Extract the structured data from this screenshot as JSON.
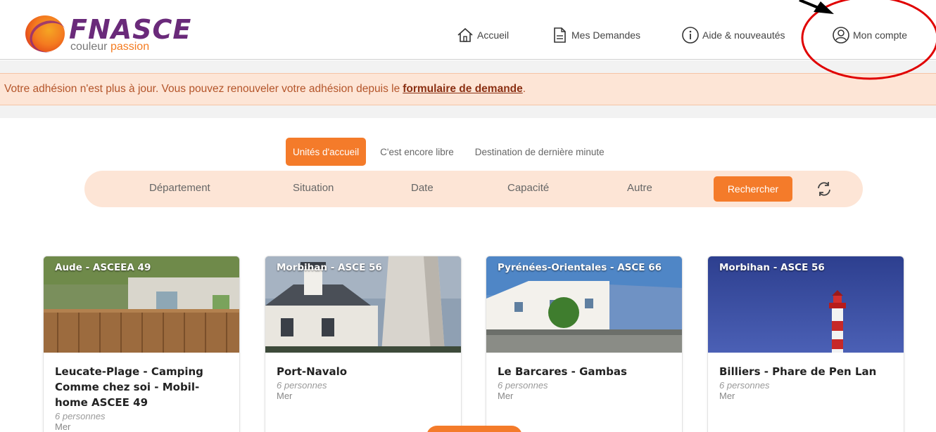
{
  "logo": {
    "name": "FNASCE",
    "tagline_a": "couleur",
    "tagline_b": "passion"
  },
  "nav": {
    "home": "Accueil",
    "requests": "Mes Demandes",
    "help": "Aide & nouveautés",
    "account": "Mon compte"
  },
  "banner": {
    "text": "Votre adhésion n'est plus à jour. Vous pouvez renouveler votre adhésion depuis le",
    "link": "formulaire de demande",
    "end": "."
  },
  "tabs": [
    "Unités d'accueil",
    "C'est encore libre",
    "Destination de dernière minute"
  ],
  "filters": {
    "department": "Département",
    "situation": "Situation",
    "date": "Date",
    "capacity": "Capacité",
    "other": "Autre",
    "search_button": "Rechercher"
  },
  "cards": [
    {
      "tag": "Aude - ASCEEA 49",
      "title": "Leucate-Plage - Camping Comme chez soi - Mobil-home ASCEE 49",
      "capacity": "6 personnes",
      "location": "Mer"
    },
    {
      "tag": "Morbihan - ASCE 56",
      "title": "Port-Navalo",
      "capacity": "6 personnes",
      "location": "Mer"
    },
    {
      "tag": "Pyrénées-Orientales - ASCE 66",
      "title": "Le Barcares - Gambas",
      "capacity": "6 personnes",
      "location": "Mer"
    },
    {
      "tag": "Morbihan - ASCE 56",
      "title": "Billiers - Phare de Pen Lan",
      "capacity": "6 personnes",
      "location": "Mer"
    }
  ],
  "colors": {
    "accent": "#f47b2a",
    "banner_bg": "#fde5d6",
    "annotation": "#e00000"
  },
  "icons": {
    "home": "home-icon",
    "requests": "document-icon",
    "help": "info-icon",
    "account": "user-circle-icon",
    "refresh": "refresh-icon"
  }
}
